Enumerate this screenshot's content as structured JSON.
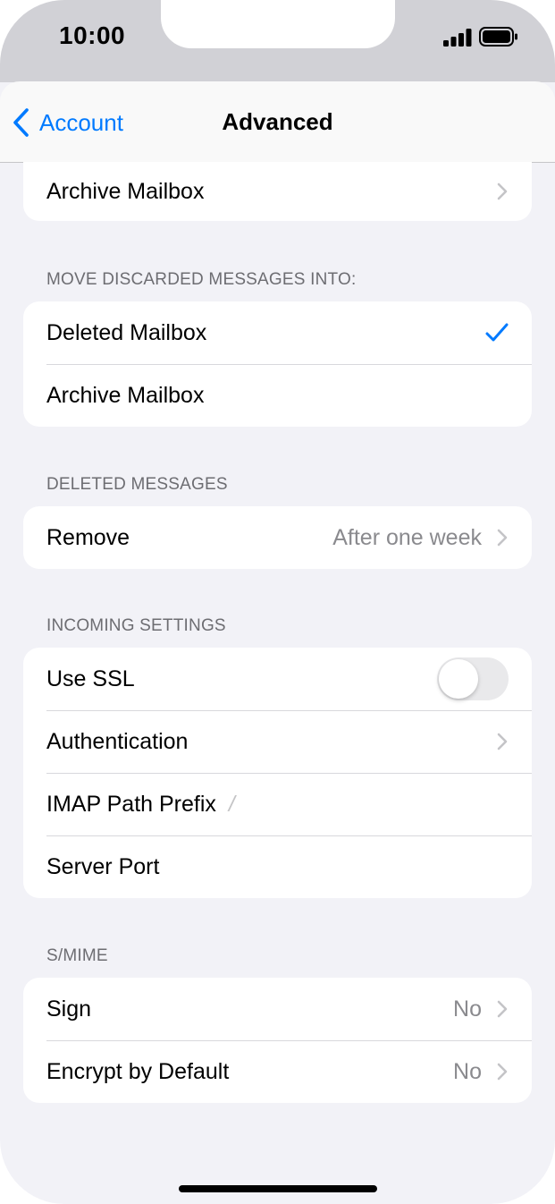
{
  "status": {
    "time": "10:00"
  },
  "nav": {
    "back_label": "Account",
    "title": "Advanced"
  },
  "top_group": {
    "label": "Archive Mailbox"
  },
  "discarded": {
    "header": "MOVE DISCARDED MESSAGES INTO:",
    "options": [
      {
        "label": "Deleted Mailbox",
        "selected": true
      },
      {
        "label": "Archive Mailbox",
        "selected": false
      }
    ]
  },
  "deleted_messages": {
    "header": "DELETED MESSAGES",
    "remove_label": "Remove",
    "remove_value": "After one week"
  },
  "incoming": {
    "header": "INCOMING SETTINGS",
    "use_ssl_label": "Use SSL",
    "use_ssl_on": false,
    "authentication_label": "Authentication",
    "imap_prefix_label": "IMAP Path Prefix",
    "imap_prefix_value": "/",
    "server_port_label": "Server Port"
  },
  "smime": {
    "header": "S/MIME",
    "sign_label": "Sign",
    "sign_value": "No",
    "encrypt_label": "Encrypt by Default",
    "encrypt_value": "No"
  },
  "colors": {
    "accent": "#007aff",
    "background": "#f2f2f7",
    "secondary_text": "#8a8a8e"
  }
}
